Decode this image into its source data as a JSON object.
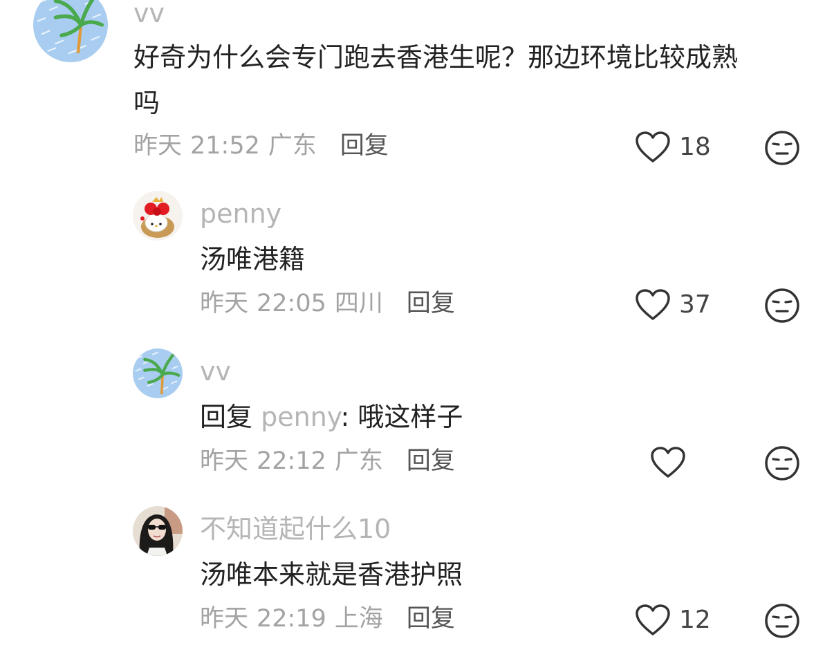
{
  "comments": [
    {
      "username": "vv",
      "text_line1": "好奇为什么会专门跑去香港生呢？那边环境比较成熟",
      "text_line2": "吗",
      "date": "昨天",
      "time": "21:52",
      "location": "广东",
      "reply_label": "回复",
      "likes": "18"
    },
    {
      "username": "penny",
      "text": "汤唯港籍",
      "date": "昨天",
      "time": "22:05",
      "location": "四川",
      "reply_label": "回复",
      "likes": "37"
    },
    {
      "username": "vv",
      "reply_prefix": "回复",
      "reply_to": "penny",
      "reply_separator": ":",
      "text": "哦这样子",
      "date": "昨天",
      "time": "22:12",
      "location": "广东",
      "reply_label": "回复",
      "likes": ""
    },
    {
      "username": "不知道起什么10",
      "text": "汤唯本来就是香港护照",
      "date": "昨天",
      "time": "22:19",
      "location": "上海",
      "reply_label": "回复",
      "likes": "12"
    }
  ],
  "colors": {
    "text_primary": "#222222",
    "text_secondary": "#a3a3a3",
    "username": "#b5b5b5",
    "icon_stroke": "#333333",
    "avatar_palm_bg": "#a9cdf0",
    "avatar_palm_leaf": "#4aa84d"
  },
  "icons": {
    "like": "heart-outline-icon",
    "dislike": "unamused-face-icon"
  }
}
